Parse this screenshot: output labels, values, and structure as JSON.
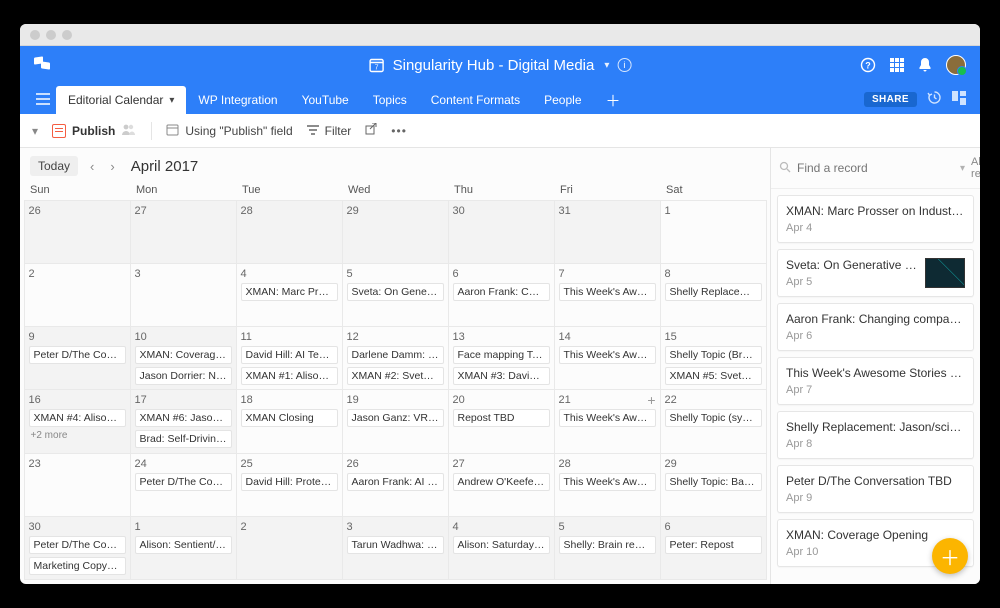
{
  "header": {
    "workspace": "Singularity Hub - Digital Media"
  },
  "tabs": {
    "items": [
      "Editorial Calendar",
      "WP Integration",
      "YouTube",
      "Topics",
      "Content Formats",
      "People"
    ],
    "share": "SHARE"
  },
  "viewbar": {
    "expand": "▾",
    "view_name": "Publish",
    "using_field": "Using \"Publish\" field",
    "filter": "Filter"
  },
  "calendar": {
    "today": "Today",
    "month": "April 2017",
    "day_headers": [
      "Sun",
      "Mon",
      "Tue",
      "Wed",
      "Thu",
      "Fri",
      "Sat"
    ],
    "weeks": [
      {
        "days": [
          {
            "n": "26",
            "out": true,
            "events": []
          },
          {
            "n": "27",
            "out": true,
            "events": []
          },
          {
            "n": "28",
            "out": true,
            "events": []
          },
          {
            "n": "29",
            "out": true,
            "events": []
          },
          {
            "n": "30",
            "out": true,
            "events": []
          },
          {
            "n": "31",
            "out": true,
            "events": []
          },
          {
            "n": "1",
            "events": []
          }
        ]
      },
      {
        "days": [
          {
            "n": "2",
            "events": []
          },
          {
            "n": "3",
            "events": []
          },
          {
            "n": "4",
            "events": [
              "XMAN: Marc Pros…"
            ]
          },
          {
            "n": "5",
            "events": [
              "Sveta: On Genera…"
            ]
          },
          {
            "n": "6",
            "events": [
              "Aaron Frank: Chan…"
            ]
          },
          {
            "n": "7",
            "events": [
              "This Week's Awes…"
            ]
          },
          {
            "n": "8",
            "events": [
              "Shelly Replaceme…"
            ]
          }
        ]
      },
      {
        "days": [
          {
            "n": "9",
            "shade": true,
            "events": [
              "Peter D/The Conv…"
            ]
          },
          {
            "n": "10",
            "shade": true,
            "events": [
              "XMAN: Coverage …",
              "Jason Dorrier: Na…"
            ]
          },
          {
            "n": "11",
            "events": [
              "David Hill: AI Teac…",
              "XMAN #1: Alison (…"
            ]
          },
          {
            "n": "12",
            "events": [
              "Darlene Damm: G…",
              "XMAN #2: Sveta (…"
            ]
          },
          {
            "n": "13",
            "events": [
              "Face mapping Tec…",
              "XMAN #3: David (…"
            ]
          },
          {
            "n": "14",
            "events": [
              "This Week's Awes…"
            ]
          },
          {
            "n": "15",
            "events": [
              "Shelly Topic (Brai…",
              "XMAN #5: Sveta (…"
            ]
          }
        ]
      },
      {
        "days": [
          {
            "n": "16",
            "shade": true,
            "events": [
              "XMAN #4: Alison …"
            ],
            "more": "+2 more"
          },
          {
            "n": "17",
            "shade": true,
            "events": [
              "XMAN #6: Jason (…",
              "Brad: Self-Driving…"
            ]
          },
          {
            "n": "18",
            "events": [
              "XMAN Closing"
            ]
          },
          {
            "n": "19",
            "events": [
              "Jason Ganz: VR M…"
            ]
          },
          {
            "n": "20",
            "events": [
              "Repost TBD"
            ]
          },
          {
            "n": "21",
            "events": [
              "This Week's Awes…"
            ],
            "plus": true
          },
          {
            "n": "22",
            "events": [
              "Shelly Topic (synt…"
            ]
          }
        ]
      },
      {
        "days": [
          {
            "n": "23",
            "events": []
          },
          {
            "n": "24",
            "events": [
              "Peter D/The Conv…"
            ]
          },
          {
            "n": "25",
            "events": [
              "David Hill: Protein…"
            ]
          },
          {
            "n": "26",
            "events": [
              "Aaron Frank: AI re…"
            ]
          },
          {
            "n": "27",
            "events": [
              "Andrew O'Keefe: …"
            ]
          },
          {
            "n": "28",
            "events": [
              "This Week's Awes…"
            ]
          },
          {
            "n": "29",
            "events": [
              "Shelly Topic: Bank…"
            ]
          }
        ]
      },
      {
        "days": [
          {
            "n": "30",
            "shade": true,
            "events": [
              "Peter D/The Conv…",
              "Marketing Copyw…"
            ]
          },
          {
            "n": "1",
            "out": true,
            "events": [
              "Alison: Sentient/a…"
            ]
          },
          {
            "n": "2",
            "out": true,
            "events": []
          },
          {
            "n": "3",
            "out": true,
            "events": [
              "Tarun Wadhwa: F…"
            ]
          },
          {
            "n": "4",
            "out": true,
            "events": [
              "Alison: Saturday C…"
            ]
          },
          {
            "n": "5",
            "out": true,
            "events": [
              "Shelly: Brain regio…"
            ]
          },
          {
            "n": "6",
            "out": true,
            "events": [
              "Peter: Repost"
            ]
          }
        ]
      }
    ]
  },
  "sidebar": {
    "search_placeholder": "Find a record",
    "all_records": "All records",
    "records": [
      {
        "title": "XMAN: Marc Prosser on Industrial …",
        "date": "Apr 4"
      },
      {
        "title": "Sveta: On Generative De…",
        "date": "Apr 5",
        "thumb": true
      },
      {
        "title": "Aaron Frank: Changing company c…",
        "date": "Apr 6"
      },
      {
        "title": "This Week's Awesome Stories Fro…",
        "date": "Apr 7"
      },
      {
        "title": "Shelly Replacement: Jason/sci-fi s…",
        "date": "Apr 8"
      },
      {
        "title": "Peter D/The Conversation TBD",
        "date": "Apr 9"
      },
      {
        "title": "XMAN: Coverage Opening",
        "date": "Apr 10"
      }
    ]
  }
}
